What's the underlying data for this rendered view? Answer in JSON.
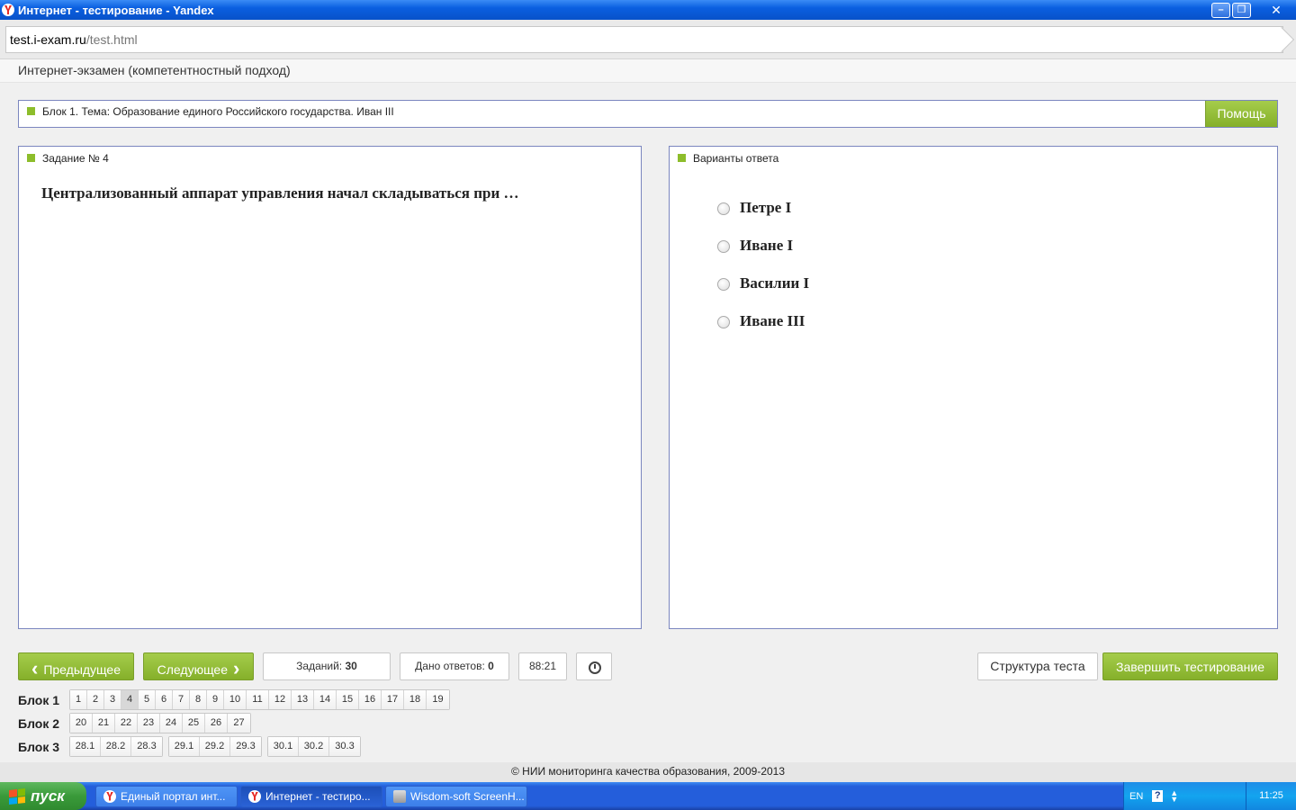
{
  "window": {
    "title": "Интернет - тестирование - Yandex",
    "minimize": "–",
    "maximize": "❐",
    "close": "✕"
  },
  "address": {
    "host": "test.i-exam.ru",
    "path": "/test.html"
  },
  "header": {
    "title": "Интернет-экзамен (компетентностный подход)"
  },
  "block_bar": {
    "text": "Блок 1. Тема: Образование единого Российского государства. Иван III",
    "help_label": "Помощь"
  },
  "task": {
    "heading": "Задание № 4",
    "question": "Централизованный аппарат управления начал складываться при …"
  },
  "answers": {
    "heading": "Варианты ответа",
    "options": [
      "Петре I",
      "Иване I",
      "Василии I",
      "Иване III"
    ]
  },
  "controls": {
    "prev_label": "Предыдущее",
    "next_label": "Следующее",
    "tasks_label": "Заданий:",
    "tasks_count": "30",
    "answered_label": "Дано ответов:",
    "answered_count": "0",
    "timer": "88:21",
    "structure_label": "Структура теста",
    "finish_label": "Завершить тестирование"
  },
  "navigation": {
    "current": "4",
    "rows": [
      {
        "label": "Блок 1",
        "groups": [
          [
            "1",
            "2",
            "3",
            "4",
            "5",
            "6",
            "7",
            "8",
            "9",
            "10",
            "11",
            "12",
            "13",
            "14",
            "15",
            "16",
            "17",
            "18",
            "19"
          ]
        ]
      },
      {
        "label": "Блок 2",
        "groups": [
          [
            "20",
            "21",
            "22",
            "23",
            "24",
            "25",
            "26",
            "27"
          ]
        ]
      },
      {
        "label": "Блок 3",
        "groups": [
          [
            "28.1",
            "28.2",
            "28.3"
          ],
          [
            "29.1",
            "29.2",
            "29.3"
          ],
          [
            "30.1",
            "30.2",
            "30.3"
          ]
        ]
      }
    ]
  },
  "footer": {
    "text": "© НИИ мониторинга качества образования, 2009-2013"
  },
  "taskbar": {
    "start_label": "пуск",
    "tasks": [
      {
        "label": "Единый портал инт...",
        "icon": "yandex-icon"
      },
      {
        "label": "Интернет - тестиро...",
        "icon": "yandex-icon"
      },
      {
        "label": "Wisdom-soft ScreenH...",
        "icon": "app-icon"
      }
    ],
    "lang": "EN",
    "clock": "11:25"
  }
}
